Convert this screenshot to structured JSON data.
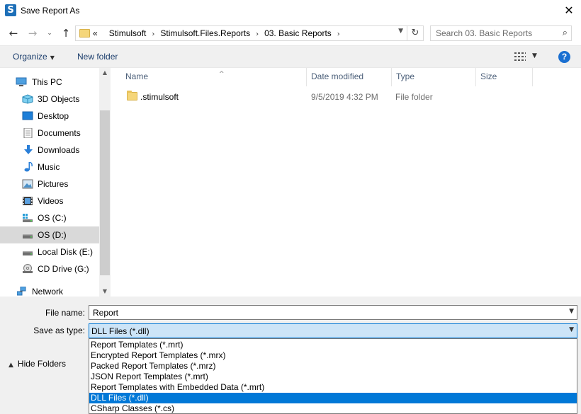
{
  "window": {
    "title": "Save Report As",
    "icon": "stimulsoft-icon",
    "icon_letter": "S",
    "close_glyph": "✕"
  },
  "nav": {
    "back_glyph": "←",
    "forward_glyph": "→",
    "recent_glyph": "⌄",
    "up_glyph": "↑"
  },
  "address": {
    "overflow": "«",
    "crumbs": [
      "Stimulsoft",
      "Stimulsoft.Files.Reports",
      "03. Basic Reports"
    ],
    "refresh_glyph": "↻"
  },
  "search": {
    "placeholder": "Search 03. Basic Reports",
    "icon_glyph": "⌕"
  },
  "toolbar": {
    "organize_label": "Organize",
    "new_folder_label": "New folder",
    "help_label": "?"
  },
  "sidebar": {
    "items": [
      {
        "label": "This PC",
        "icon": "pc-icon"
      },
      {
        "label": "3D Objects",
        "icon": "3d-objects-icon"
      },
      {
        "label": "Desktop",
        "icon": "desktop-icon"
      },
      {
        "label": "Documents",
        "icon": "documents-icon"
      },
      {
        "label": "Downloads",
        "icon": "downloads-icon"
      },
      {
        "label": "Music",
        "icon": "music-icon"
      },
      {
        "label": "Pictures",
        "icon": "pictures-icon"
      },
      {
        "label": "Videos",
        "icon": "videos-icon"
      },
      {
        "label": "OS (C:)",
        "icon": "os-drive-icon"
      },
      {
        "label": "OS (D:)",
        "icon": "drive-icon",
        "selected": true
      },
      {
        "label": "Local Disk (E:)",
        "icon": "drive-icon"
      },
      {
        "label": "CD Drive (G:)",
        "icon": "cd-drive-icon"
      },
      {
        "label": "Network",
        "icon": "network-icon"
      }
    ]
  },
  "files": {
    "columns": [
      "Name",
      "Date modified",
      "Type",
      "Size"
    ],
    "rows": [
      {
        "name": ".stimulsoft",
        "date": "9/5/2019 4:32 PM",
        "type": "File folder",
        "size": ""
      }
    ]
  },
  "form": {
    "filename_label": "File name:",
    "filename_value": "Report",
    "savetype_label": "Save as type:",
    "savetype_value": "DLL Files (*.dll)",
    "hide_folders_label": "Hide Folders"
  },
  "type_options": [
    "Report Templates (*.mrt)",
    "Encrypted Report Templates (*.mrx)",
    "Packed Report Templates (*.mrz)",
    "JSON Report Templates (*.mrt)",
    "Report Templates with Embedded Data (*.mrt)",
    "DLL Files (*.dll)",
    "CSharp Classes (*.cs)"
  ],
  "colors": {
    "accent": "#0078d7",
    "selection_bg": "#cce4f7",
    "folder": "#f5d67a"
  }
}
